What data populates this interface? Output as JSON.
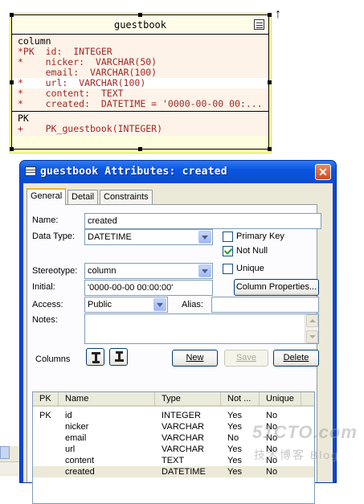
{
  "er_table": {
    "name": "guestbook",
    "sections": [
      {
        "lines": [
          {
            "text": "column",
            "type": "hdr"
          },
          {
            "text": "*PK  id:  INTEGER"
          },
          {
            "text": "*    nicker:  VARCHAR(50)"
          },
          {
            "text": "     email:  VARCHAR(100)"
          },
          {
            "text": "*    url:  VARCHAR(100)",
            "selected": true
          },
          {
            "text": "*    content:  TEXT"
          },
          {
            "text": "*    created:  DATETIME = '0000-00-00 00:..."
          }
        ]
      },
      {
        "lines": [
          {
            "text": "PK",
            "type": "hdr"
          },
          {
            "text": "+    PK_guestbook(INTEGER)"
          }
        ]
      }
    ]
  },
  "dialog": {
    "title": "guestbook Attributes: created",
    "close_label": "✕",
    "tabs": [
      "General",
      "Detail",
      "Constraints"
    ],
    "fields": {
      "name_label": "Name:",
      "name_value": "created",
      "datatype_label": "Data Type:",
      "datatype_value": "DATETIME",
      "stereotype_label": "Stereotype:",
      "stereotype_value": "column",
      "initial_label": "Initial:",
      "initial_value": "'0000-00-00 00:00:00'",
      "access_label": "Access:",
      "access_value": "Public",
      "alias_label": "Alias:",
      "alias_value": "",
      "notes_label": "Notes:",
      "notes_value": ""
    },
    "checkboxes": [
      {
        "label": "Primary Key",
        "checked": false
      },
      {
        "label": "Not Null",
        "checked": true
      },
      {
        "label": "Unique",
        "checked": false
      }
    ],
    "column_properties_label": "Column Properties...",
    "columns_label": "Columns",
    "buttons": {
      "new": "New",
      "save": "Save",
      "delete": "Delete"
    },
    "list": {
      "headers": [
        "PK",
        "Name",
        "Type",
        "Not ...",
        "Unique"
      ],
      "rows": [
        [
          "PK",
          "id",
          "INTEGER",
          "Yes",
          "No"
        ],
        [
          "",
          "nicker",
          "VARCHAR",
          "Yes",
          "No"
        ],
        [
          "",
          "email",
          "VARCHAR",
          "No",
          "No"
        ],
        [
          "",
          "url",
          "VARCHAR",
          "Yes",
          "No"
        ],
        [
          "",
          "content",
          "TEXT",
          "Yes",
          "No"
        ],
        [
          "",
          "created",
          "DATETIME",
          "Yes",
          "No"
        ]
      ],
      "selected_row": 5
    }
  },
  "watermark": {
    "line1": "51CTO.com",
    "line2": "技术博客 Blog"
  }
}
